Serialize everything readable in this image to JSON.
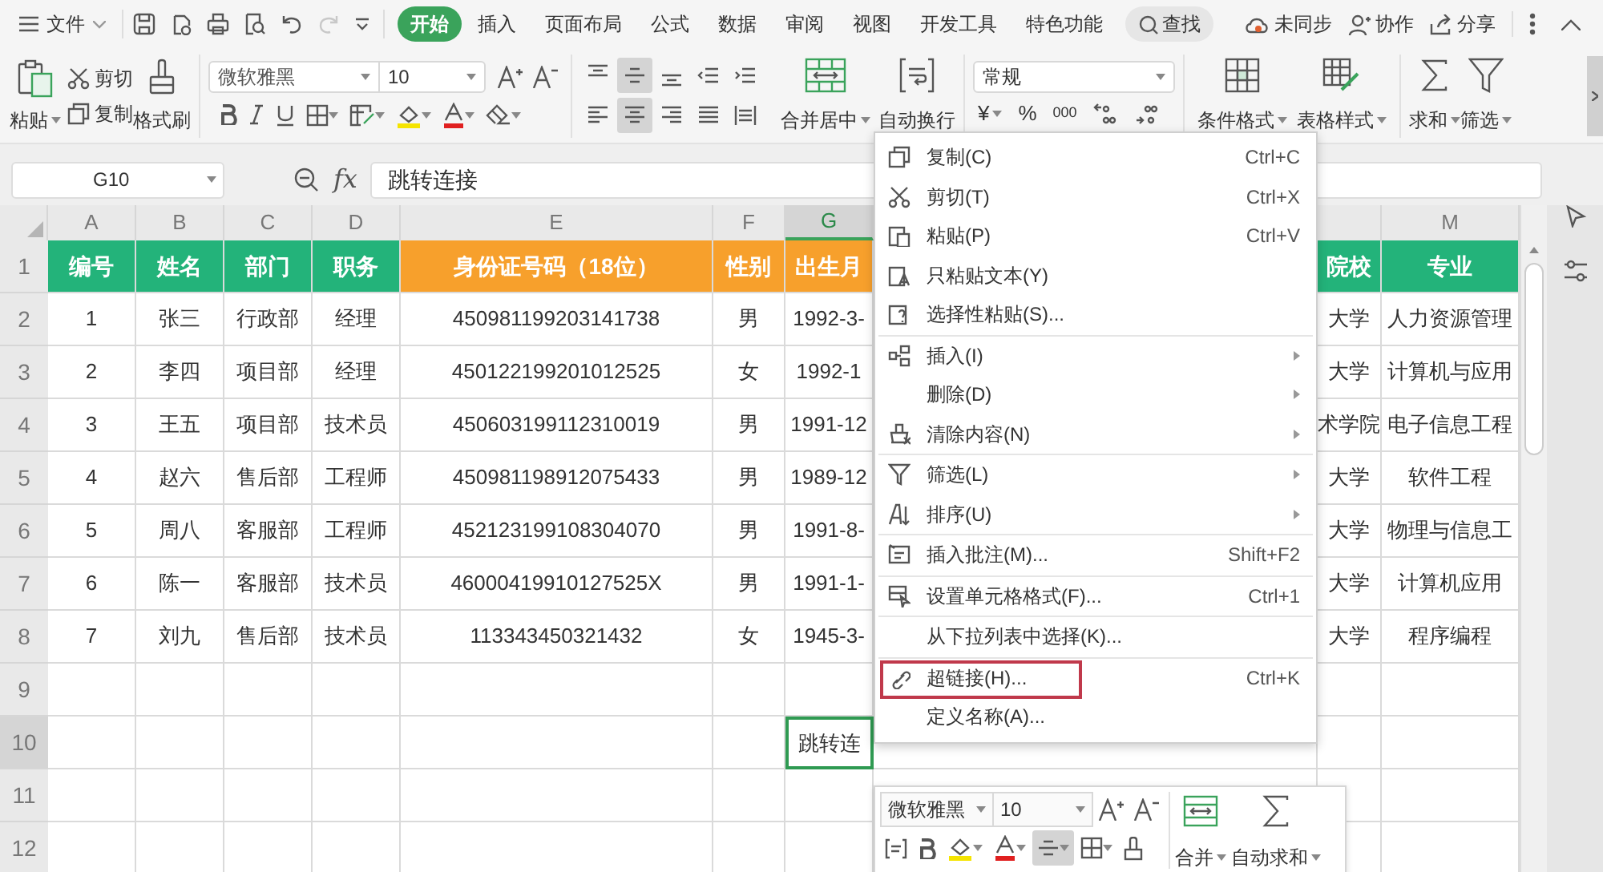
{
  "menu_bar": {
    "file": "文件",
    "tabs": [
      {
        "label": "开始",
        "selected": true
      },
      {
        "label": "插入",
        "selected": false
      },
      {
        "label": "页面布局",
        "selected": false
      },
      {
        "label": "公式",
        "selected": false
      },
      {
        "label": "数据",
        "selected": false
      },
      {
        "label": "审阅",
        "selected": false
      },
      {
        "label": "视图",
        "selected": false
      },
      {
        "label": "开发工具",
        "selected": false
      },
      {
        "label": "特色功能",
        "selected": false
      }
    ],
    "search": "查找",
    "sync": "未同步",
    "collaborate": "协作",
    "share": "分享"
  },
  "ribbon": {
    "paste": "粘贴",
    "cut": "剪切",
    "copy": "复制",
    "format_painter": "格式刷",
    "font": "微软雅黑",
    "font_size": "10",
    "align_buttons": [
      {
        "selected": false
      },
      {
        "selected": true
      },
      {
        "selected": false
      },
      {
        "selected": false
      },
      {
        "selected": false
      },
      {
        "selected": false
      },
      {
        "selected": true
      },
      {
        "selected": false
      },
      {
        "selected": false
      },
      {
        "selected": false
      }
    ],
    "merge": "合并居中",
    "wrap": "自动换行",
    "number_format": "常规",
    "currency": "¥",
    "percent": "%",
    "thousands": "000",
    "conditional_format": "条件格式",
    "table_style": "表格样式",
    "sum": "求和",
    "filter": "筛选"
  },
  "formula_bar": {
    "name_box": "G10",
    "function_label": "fx",
    "formula": "跳转连接"
  },
  "sheet": {
    "columns": [
      {
        "label": "A",
        "selected": false
      },
      {
        "label": "B",
        "selected": false
      },
      {
        "label": "C",
        "selected": false
      },
      {
        "label": "D",
        "selected": false
      },
      {
        "label": "E",
        "selected": false
      },
      {
        "label": "F",
        "selected": false
      },
      {
        "label": "G",
        "selected": true
      },
      {
        "selected": false
      },
      {
        "label": "M",
        "selected": false
      }
    ],
    "rows": [
      {
        "number": "1",
        "selected": false,
        "cells": [
          {
            "text": "编号",
            "color": "#23b37a"
          },
          {
            "text": "姓名",
            "color": "#23b37a"
          },
          {
            "text": "部门",
            "color": "#23b37a"
          },
          {
            "text": "职务",
            "color": "#23b37a"
          },
          {
            "text": "身份证号码（18位）",
            "color": "#f7a02c"
          },
          {
            "text": "性别",
            "color": "#f7a02c"
          },
          {
            "text": "出生月",
            "color": "#f7a02c"
          },
          {
            "text": "院校",
            "color": "#23b37a"
          },
          {
            "text": "专业",
            "color": "#23b37a"
          }
        ]
      },
      {
        "number": "2",
        "selected": false,
        "cells": [
          "1",
          "张三",
          "行政部",
          "经理",
          "450981199203141738",
          "男",
          "1992-3-",
          "大学",
          "人力资源管理"
        ]
      },
      {
        "number": "3",
        "selected": false,
        "cells": [
          "2",
          "李四",
          "项目部",
          "经理",
          "450122199201012525",
          "女",
          "1992-1",
          "大学",
          "计算机与应用"
        ]
      },
      {
        "number": "4",
        "selected": false,
        "cells": [
          "3",
          "王五",
          "项目部",
          "技术员",
          "450603199112310019",
          "男",
          "1991-12",
          "术学院",
          "电子信息工程"
        ]
      },
      {
        "number": "5",
        "selected": false,
        "cells": [
          "4",
          "赵六",
          "售后部",
          "工程师",
          "450981198912075433",
          "男",
          "1989-12",
          "大学",
          "软件工程"
        ]
      },
      {
        "number": "6",
        "selected": false,
        "cells": [
          "5",
          "周八",
          "客服部",
          "工程师",
          "452123199108304070",
          "男",
          "1991-8-",
          "大学",
          "物理与信息工"
        ]
      },
      {
        "number": "7",
        "selected": false,
        "cells": [
          "6",
          "陈一",
          "客服部",
          "技术员",
          "46000419910127525X",
          "男",
          "1991-1-",
          "大学",
          "计算机应用"
        ]
      },
      {
        "number": "8",
        "selected": false,
        "cells": [
          "7",
          "刘九",
          "售后部",
          "技术员",
          "113343450321432",
          "女",
          "1945-3-",
          "大学",
          "程序编程"
        ]
      },
      {
        "number": "9",
        "selected": false,
        "cells": []
      },
      {
        "number": "10",
        "selected": true,
        "cells": [
          "",
          "",
          "",
          "",
          "",
          "",
          "跳转连"
        ]
      },
      {
        "number": "11",
        "selected": false,
        "cells": []
      },
      {
        "number": "12",
        "selected": false,
        "cells": []
      }
    ]
  },
  "context_menu": [
    {
      "kind": "item",
      "label": "复制(C)",
      "shortcut": "Ctrl+C",
      "submenu": false,
      "highlighted": false
    },
    {
      "kind": "item",
      "label": "剪切(T)",
      "shortcut": "Ctrl+X",
      "submenu": false,
      "highlighted": false
    },
    {
      "kind": "item",
      "label": "粘贴(P)",
      "shortcut": "Ctrl+V",
      "submenu": false,
      "highlighted": false
    },
    {
      "kind": "item",
      "label": "只粘贴文本(Y)",
      "submenu": false,
      "highlighted": false
    },
    {
      "kind": "item",
      "label": "选择性粘贴(S)...",
      "submenu": false,
      "highlighted": false
    },
    {
      "kind": "separator"
    },
    {
      "kind": "item",
      "label": "插入(I)",
      "submenu": true,
      "highlighted": false
    },
    {
      "kind": "item",
      "label": "删除(D)",
      "submenu": true,
      "highlighted": false
    },
    {
      "kind": "item",
      "label": "清除内容(N)",
      "submenu": true,
      "highlighted": false
    },
    {
      "kind": "separator"
    },
    {
      "kind": "item",
      "label": "筛选(L)",
      "submenu": true,
      "highlighted": false
    },
    {
      "kind": "item",
      "label": "排序(U)",
      "submenu": true,
      "highlighted": false
    },
    {
      "kind": "separator"
    },
    {
      "kind": "item",
      "label": "插入批注(M)...",
      "shortcut": "Shift+F2",
      "submenu": false,
      "highlighted": false
    },
    {
      "kind": "separator"
    },
    {
      "kind": "item",
      "label": "设置单元格格式(F)...",
      "shortcut": "Ctrl+1",
      "submenu": false,
      "highlighted": false
    },
    {
      "kind": "separator"
    },
    {
      "kind": "item",
      "label": "从下拉列表中选择(K)...",
      "submenu": false,
      "highlighted": false
    },
    {
      "kind": "separator"
    },
    {
      "kind": "item",
      "label": "超链接(H)...",
      "shortcut": "Ctrl+K",
      "submenu": false,
      "highlighted": true
    },
    {
      "kind": "item",
      "label": "定义名称(A)...",
      "submenu": false,
      "highlighted": false
    }
  ],
  "mini_toolbar": {
    "font": "微软雅黑",
    "font_size": "10",
    "center_align": {
      "selected": true
    },
    "merge": "合并",
    "autosum": "自动求和"
  }
}
